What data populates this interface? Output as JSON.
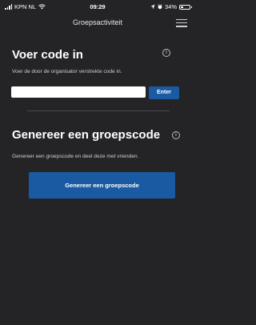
{
  "status_bar": {
    "carrier": "KPN NL",
    "time": "09:29",
    "battery": "34%",
    "battery_fill": 0.34
  },
  "nav": {
    "title": "Groepsactiviteit",
    "menu_icon": "hamburger-menu-icon"
  },
  "enter_code": {
    "heading": "Voer code in",
    "description": "Voer de door de organisator verstrekte code in.",
    "input_value": "",
    "enter_label": "Enter",
    "info_icon": "info-icon"
  },
  "generate": {
    "heading": "Genereer een groepscode",
    "description": "Genereer een groepscode en deel deze met vrienden.",
    "button_label": "Genereer een groepscode",
    "info_icon": "info-icon"
  },
  "colors": {
    "background": "#242427",
    "accent": "#1a5aa3"
  }
}
